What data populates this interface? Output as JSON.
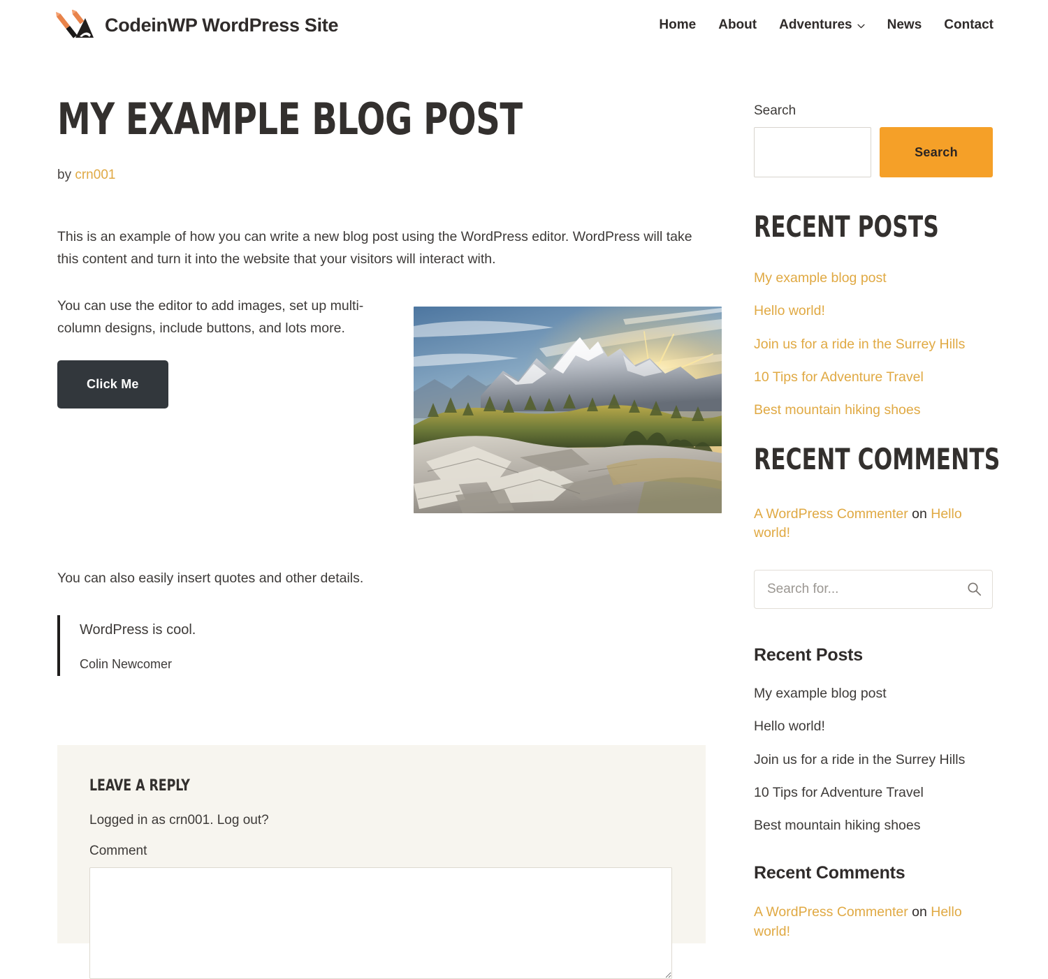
{
  "header": {
    "brand_title": "CodeinWP WordPress Site",
    "logo_icon": "pen-over-mountain-logo",
    "nav": [
      {
        "label": "Home",
        "has_dropdown": false
      },
      {
        "label": "About",
        "has_dropdown": false
      },
      {
        "label": "Adventures",
        "has_dropdown": true
      },
      {
        "label": "News",
        "has_dropdown": false
      },
      {
        "label": "Contact",
        "has_dropdown": false
      }
    ]
  },
  "post": {
    "title": "My example blog post",
    "byline_prefix": "by",
    "author": "crn001",
    "paragraph_1": "This is an example of how you can write a new blog post using the WordPress editor. WordPress will take this content and turn it into the website that your visitors will interact with.",
    "paragraph_2": "You can use the editor to add images, set up multi-column designs, include buttons, and lots more.",
    "button_label": "Click Me",
    "image_alt": "mountain-sunrise-photo",
    "paragraph_3": "You can also easily insert quotes and other details.",
    "quote_text": "WordPress is cool.",
    "quote_cite": "Colin Newcomer"
  },
  "comment_form": {
    "heading": "Leave a Reply",
    "logged_in_text": "Logged in as crn001. Log out?",
    "comment_label": "Comment",
    "comment_value": ""
  },
  "sidebar": {
    "search_widget": {
      "label": "Search",
      "input_value": "",
      "button_label": "Search"
    },
    "recent_posts_display": {
      "heading": "Recent Posts",
      "items": [
        "My example blog post",
        "Hello world!",
        "Join us for a ride in the Surrey Hills",
        "10 Tips for Adventure Travel",
        "Best mountain hiking shoes"
      ]
    },
    "recent_comments_display": {
      "heading": "Recent Comments",
      "comment_author": "A WordPress Commenter",
      "comment_on": " on ",
      "comment_post": "Hello world!"
    },
    "search_box_2": {
      "placeholder": "Search for...",
      "value": "",
      "icon": "search-icon"
    },
    "recent_posts_plain": {
      "heading": "Recent Posts",
      "items": [
        "My example blog post",
        "Hello world!",
        "Join us for a ride in the Surrey Hills",
        "10 Tips for Adventure Travel",
        "Best mountain hiking shoes"
      ]
    },
    "recent_comments_plain": {
      "heading": "Recent Comments",
      "comment_author": "A WordPress Commenter",
      "comment_on": " on ",
      "comment_post": "Hello world!"
    }
  },
  "colors": {
    "accent_orange": "#f5a028",
    "link_gold": "#e0a943",
    "dark_text": "#33302e",
    "button_dark": "#32373c",
    "panel_cream": "#f7f5ef"
  }
}
